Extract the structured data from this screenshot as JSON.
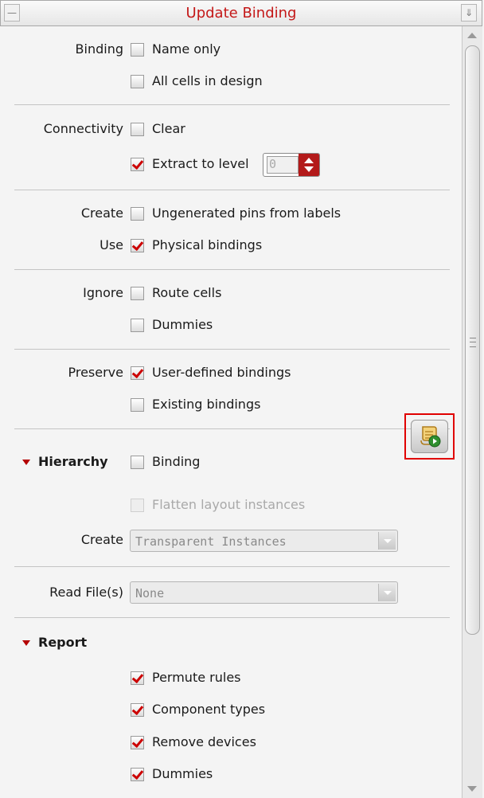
{
  "window": {
    "title": "Update Binding"
  },
  "binding": {
    "label": "Binding",
    "name_only": {
      "label": "Name only",
      "checked": false
    },
    "all_cells": {
      "label": "All cells in design",
      "checked": false
    }
  },
  "connectivity": {
    "label": "Connectivity",
    "clear": {
      "label": "Clear",
      "checked": false
    },
    "extract": {
      "label": "Extract to level",
      "checked": true,
      "level": "0"
    }
  },
  "create": {
    "label": "Create",
    "ungenerated": {
      "label": "Ungenerated pins from labels",
      "checked": false
    }
  },
  "use": {
    "label": "Use",
    "physical": {
      "label": "Physical bindings",
      "checked": true
    }
  },
  "ignore": {
    "label": "Ignore",
    "route_cells": {
      "label": "Route cells",
      "checked": false
    },
    "dummies": {
      "label": "Dummies",
      "checked": false
    }
  },
  "preserve": {
    "label": "Preserve",
    "user_defined": {
      "label": "User-defined bindings",
      "checked": true
    },
    "existing": {
      "label": "Existing bindings",
      "checked": false
    }
  },
  "hierarchy": {
    "label": "Hierarchy",
    "binding": {
      "label": "Binding",
      "checked": false
    },
    "flatten": {
      "label": "Flatten layout instances",
      "checked": false,
      "enabled": false
    },
    "create_label": "Create",
    "create_value": "Transparent Instances",
    "run_icon": "script-run-icon"
  },
  "read_file": {
    "label": "Read File(s)",
    "value": "None"
  },
  "report": {
    "label": "Report",
    "permute": {
      "label": "Permute rules",
      "checked": true
    },
    "component": {
      "label": "Component types",
      "checked": true
    },
    "remove": {
      "label": "Remove devices",
      "checked": true
    },
    "dummies": {
      "label": "Dummies",
      "checked": true
    }
  },
  "colors": {
    "title": "#c41818",
    "check": "#cc0000",
    "accent": "#b31a1a"
  }
}
